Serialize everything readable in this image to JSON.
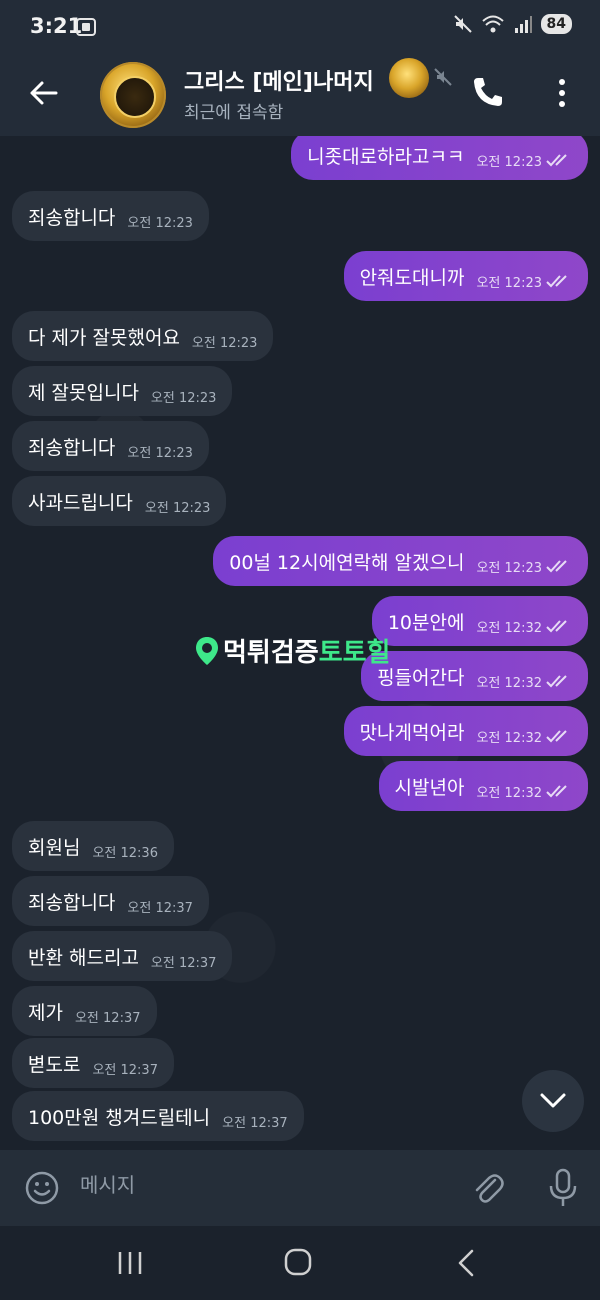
{
  "status_bar": {
    "time": "3:21",
    "battery": "84"
  },
  "header": {
    "title": "그리스 [메인]나머지",
    "subtitle": "최근에 접속함"
  },
  "messages": [
    {
      "dir": "out",
      "text": "니좃대로하라고ㅋㅋ",
      "time": "오전 12:23"
    },
    {
      "dir": "in",
      "text": "죄송합니다",
      "time": "오전 12:23"
    },
    {
      "dir": "out",
      "text": "안줘도대니까",
      "time": "오전 12:23"
    },
    {
      "dir": "in",
      "text": "다 제가 잘못했어요",
      "time": "오전 12:23"
    },
    {
      "dir": "in",
      "text": "제 잘못입니다",
      "time": "오전 12:23"
    },
    {
      "dir": "in",
      "text": "죄송합니다",
      "time": "오전 12:23"
    },
    {
      "dir": "in",
      "text": "사과드립니다",
      "time": "오전 12:23"
    },
    {
      "dir": "out",
      "text": "00널 12시에연락해 알겠으니",
      "time": "오전 12:23"
    },
    {
      "dir": "out",
      "text": "10분안에",
      "time": "오전 12:32"
    },
    {
      "dir": "out",
      "text": "핑들어간다",
      "time": "오전 12:32"
    },
    {
      "dir": "out",
      "text": "맛나게먹어라",
      "time": "오전 12:32"
    },
    {
      "dir": "out",
      "text": "시발년아",
      "time": "오전 12:32"
    },
    {
      "dir": "in",
      "text": "회원님",
      "time": "오전 12:36"
    },
    {
      "dir": "in",
      "text": "죄송합니다",
      "time": "오전 12:37"
    },
    {
      "dir": "in",
      "text": "반환 해드리고",
      "time": "오전 12:37"
    },
    {
      "dir": "in",
      "text": "제가",
      "time": "오전 12:37"
    },
    {
      "dir": "in",
      "text": "볃도로",
      "time": "오전 12:37"
    },
    {
      "dir": "in",
      "text": "100만원 챙겨드릴테니",
      "time": "오전 12:37"
    }
  ],
  "watermark": {
    "part1": "먹튀검증",
    "part2": "토토힐"
  },
  "input": {
    "placeholder": "메시지"
  },
  "colors": {
    "outgoing": "#8a44cc",
    "incoming": "#2a323d",
    "background": "#1b222c",
    "watermark_accent": "#3ee88a"
  }
}
